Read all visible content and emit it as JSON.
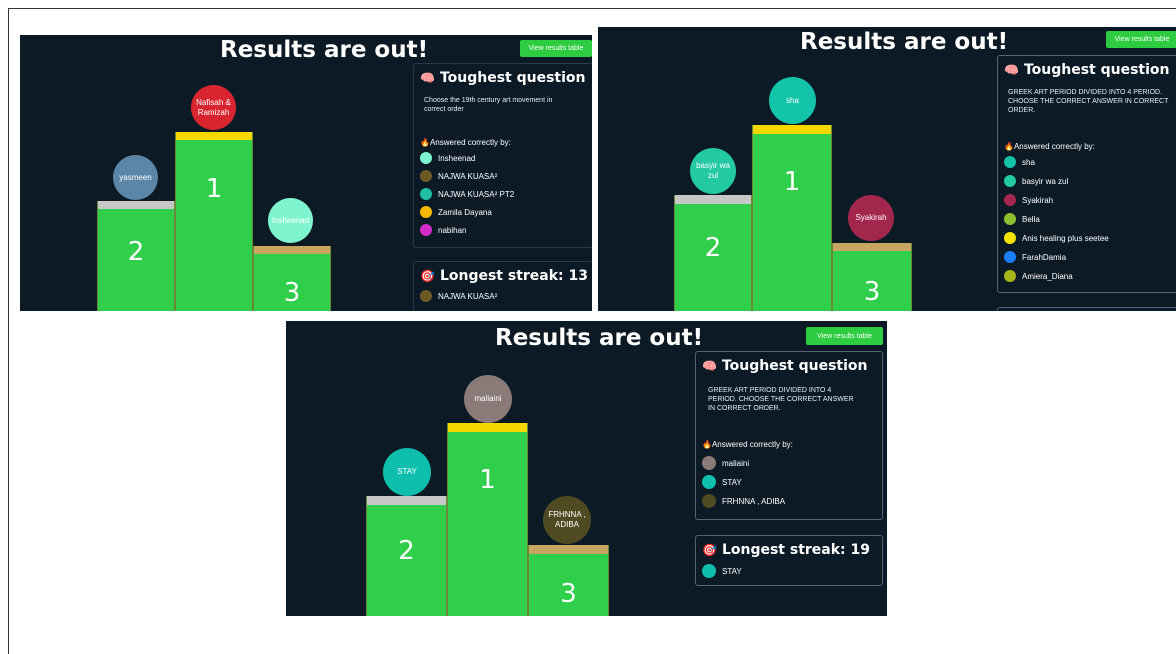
{
  "shots": [
    {
      "title": "Results are out!",
      "button": "View results table",
      "podium": {
        "first": {
          "name": "Nafisah &\nRamizah",
          "color": "#d9252f",
          "number": "1"
        },
        "second": {
          "name": "yasmeen",
          "color": "#5b86a8",
          "number": "2"
        },
        "third": {
          "name": "Insheenad",
          "color": "#7ff5cf",
          "number": "3"
        }
      },
      "toughest": {
        "title": "Toughest question",
        "question": "Choose the 19th century art movement in correct order",
        "answered_label": "Answered correctly by:",
        "players": [
          {
            "name": "Insheenad",
            "color": "#7ff5cf"
          },
          {
            "name": "NAJWA KUASA²",
            "color": "#6b5a26"
          },
          {
            "name": "NAJWA KUASA² PT2",
            "color": "#1fbfa6"
          },
          {
            "name": "Zamila Dayana",
            "color": "#f5b800"
          },
          {
            "name": "nabihan",
            "color": "#d42cc8"
          }
        ]
      },
      "streak": {
        "title": "Longest streak: 13",
        "players": [
          {
            "name": "NAJWA KUASA²",
            "color": "#6b5a26"
          }
        ]
      }
    },
    {
      "title": "Results are out!",
      "button": "View results table",
      "podium": {
        "first": {
          "name": "sha",
          "color": "#13c4ab",
          "number": "1"
        },
        "second": {
          "name": "basyir wa\nzul",
          "color": "#22c9a3",
          "number": "2"
        },
        "third": {
          "name": "Syakirah",
          "color": "#a3264d",
          "number": "3"
        }
      },
      "toughest": {
        "title": "Toughest question",
        "question": "GREEK ART PERIOD DIVIDED INTO 4 PERIOD. CHOOSE THE CORRECT ANSWER IN CORRECT ORDER.",
        "answered_label": "Answered correctly by:",
        "players": [
          {
            "name": "sha",
            "color": "#13c4ab"
          },
          {
            "name": "basyir wa zul",
            "color": "#22c9a3"
          },
          {
            "name": "Syakirah",
            "color": "#a3264d"
          },
          {
            "name": "Bella",
            "color": "#8fbf2e"
          },
          {
            "name": "Anis healing plus seetee",
            "color": "#f5e400"
          },
          {
            "name": "FarahDamia",
            "color": "#1a7fff"
          },
          {
            "name": "Amiera_Diana",
            "color": "#a9b61a"
          }
        ]
      }
    },
    {
      "title": "Results are out!",
      "button": "View results table",
      "podium": {
        "first": {
          "name": "maliaini",
          "color": "#8a7b78",
          "number": "1"
        },
        "second": {
          "name": "STAY",
          "color": "#0fbfae",
          "number": "2"
        },
        "third": {
          "name": "FRHNNA ,\nADIBA",
          "color": "#4f4a22",
          "number": "3"
        }
      },
      "toughest": {
        "title": "Toughest question",
        "question": "GREEK ART PERIOD DIVIDED INTO 4 PERIOD. CHOOSE THE CORRECT ANSWER IN CORRECT ORDER.",
        "answered_label": "Answered correctly by:",
        "players": [
          {
            "name": "maliaini",
            "color": "#8a7b78"
          },
          {
            "name": "STAY",
            "color": "#0fbfae"
          },
          {
            "name": "FRHNNA , ADIBA",
            "color": "#4f4a22"
          }
        ]
      },
      "streak": {
        "title": "Longest streak: 19",
        "players": [
          {
            "name": "STAY",
            "color": "#0fbfae"
          }
        ]
      }
    }
  ]
}
